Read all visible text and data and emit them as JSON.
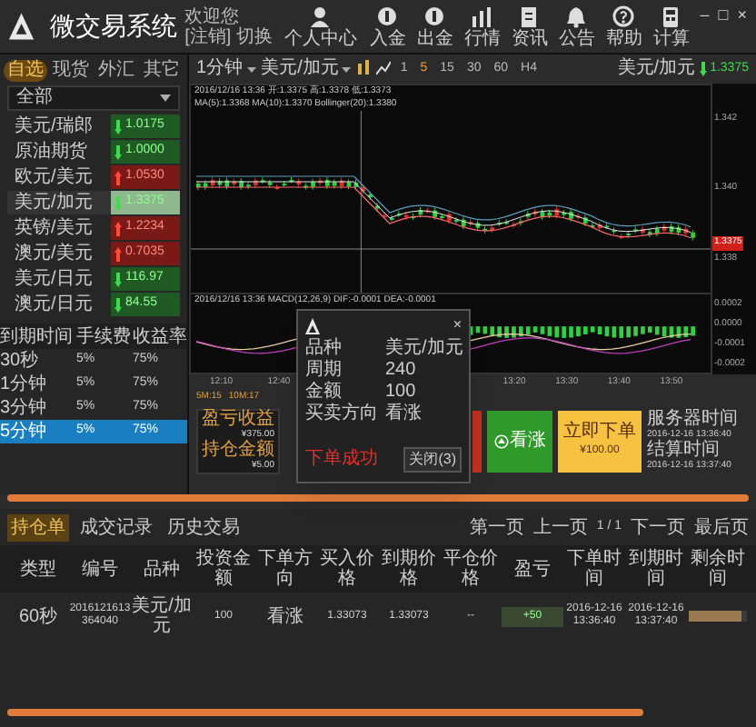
{
  "window": {
    "title": "微交易系统",
    "welcome": "欢迎您",
    "account_links": "[注销] 切换",
    "user_label": "个人中心",
    "controls": [
      "–",
      "□",
      "×"
    ]
  },
  "toolbar": [
    {
      "label": "入金"
    },
    {
      "label": "出金"
    },
    {
      "label": "行情"
    },
    {
      "label": "资讯"
    },
    {
      "label": "公告"
    },
    {
      "label": "帮助"
    },
    {
      "label": "计算"
    }
  ],
  "market_tabs": [
    {
      "label": "自选",
      "selected": true
    },
    {
      "label": "现货",
      "selected": false
    },
    {
      "label": "外汇",
      "selected": false
    },
    {
      "label": "其它",
      "selected": false
    }
  ],
  "filter": {
    "value": "全部"
  },
  "instruments": [
    {
      "name": "美元/瑞郎",
      "price": "1.0175",
      "rising": false,
      "selected": false
    },
    {
      "name": "原油期货",
      "price": "1.0000",
      "rising": false,
      "selected": false
    },
    {
      "name": "欧元/美元",
      "price": "1.0530",
      "rising": true,
      "selected": false
    },
    {
      "name": "美元/加元",
      "price": "1.3375",
      "rising": false,
      "selected": true
    },
    {
      "name": "英镑/美元",
      "price": "1.2234",
      "rising": true,
      "selected": false
    },
    {
      "name": "澳元/美元",
      "price": "0.7035",
      "rising": true,
      "selected": false
    },
    {
      "name": "美元/日元",
      "price": "116.97",
      "rising": false,
      "selected": false
    },
    {
      "name": "澳元/日元",
      "price": "84.55",
      "rising": false,
      "selected": false
    }
  ],
  "expiry": {
    "columns": [
      "到期时间",
      "手续费",
      "收益率"
    ],
    "rows": [
      {
        "cells": [
          "30秒",
          "5%",
          "75%"
        ],
        "selected": false
      },
      {
        "cells": [
          "1分钟",
          "5%",
          "75%"
        ],
        "selected": false
      },
      {
        "cells": [
          "3分钟",
          "5%",
          "75%"
        ],
        "selected": false
      },
      {
        "cells": [
          "5分钟",
          "5%",
          "75%"
        ],
        "selected": true
      }
    ]
  },
  "chart": {
    "period": "1分钟",
    "symbol": "美元/加元",
    "timeframes": [
      {
        "label": "1",
        "selected": false
      },
      {
        "label": "5",
        "selected": true
      },
      {
        "label": "15",
        "selected": false
      },
      {
        "label": "30",
        "selected": false
      },
      {
        "label": "60",
        "selected": false
      },
      {
        "label": "H4",
        "selected": false
      }
    ],
    "quote": {
      "symbol": "美元/加元",
      "price": "1.3375"
    },
    "legend": [
      "2016/12/16 13:36 开:1.3375 高:1.3378 低:1.3373",
      "MA(5):1.3368 MA(10):1.3370 Bollinger(20):1.3380"
    ],
    "y_ticks": [
      "1.342",
      "1.340",
      "1.338"
    ],
    "price_tag": "1.3375",
    "macd_legend": "2016/12/16 13:36 MACD(12,26,9) DIF:-0.0001 DEA:-0.0001",
    "macd_ticks": [
      "0.0002",
      "0.0000",
      "-0.0001",
      "-0.0002"
    ],
    "x_ticks": [
      "12:10",
      "12:40",
      "13:20",
      "13:30",
      "13:40",
      "13:50"
    ],
    "ma_labels": [
      "5M:15",
      "10M:17"
    ]
  },
  "dialog": {
    "rows": [
      {
        "label": "品种",
        "value": "美元/加元"
      },
      {
        "label": "周期",
        "value": "240"
      },
      {
        "label": "金额",
        "value": "100"
      },
      {
        "label": "买卖方向",
        "value": "看涨"
      }
    ],
    "message": "下单成功",
    "button": "关闭(3)",
    "close": "×"
  },
  "trade": {
    "balance": [
      {
        "label": "盈亏收益",
        "value": "¥375.00"
      },
      {
        "label": "持仓金额",
        "value": "¥5.00"
      }
    ],
    "buy_button": "看涨",
    "order_button": [
      "立即下单",
      "¥100.00"
    ],
    "times": [
      {
        "label": "服务器时间",
        "value": "2016-12-16 13:36:40"
      },
      {
        "label": "结算时间",
        "value": "2016-12-16 13:37:40"
      }
    ]
  },
  "orders": {
    "tabs": [
      {
        "label": "持仓单",
        "selected": true
      },
      {
        "label": "成交记录",
        "selected": false
      },
      {
        "label": "历史交易",
        "selected": false
      }
    ],
    "pager": [
      "第一页",
      "上一页",
      "1 / 1",
      "下一页",
      "最后页"
    ],
    "columns": [
      "类型",
      "编号",
      "品种",
      "投资金额",
      "下单方向",
      "买入价格",
      "到期价格",
      "平仓价格",
      "盈亏",
      "下单时间",
      "到期时间",
      "剩余时间"
    ],
    "rows": [
      {
        "cells": [
          "60秒",
          "2016121613364040",
          "美元/加元",
          "100",
          "看涨",
          "1.33073",
          "1.33073",
          "--",
          "+50",
          "2016-12-16 13:36:40",
          "2016-12-16 13:37:40"
        ],
        "level": 0.9
      }
    ]
  }
}
